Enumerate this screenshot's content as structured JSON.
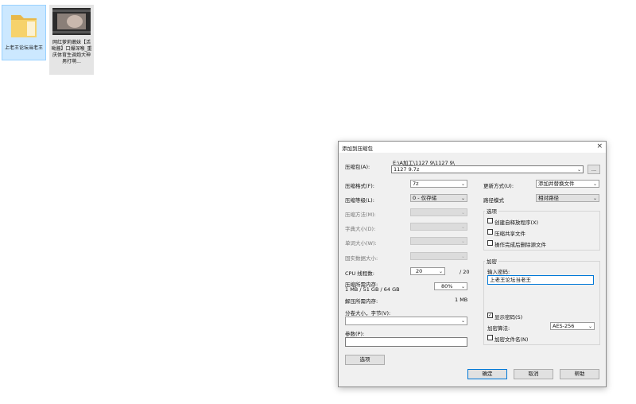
{
  "desktop": {
    "folder_label": "上老王论坛当老王",
    "video_label": "网红萝莉嫩妹【活呦酱】口爆深喉_重庆体育生调炮大神男打萌..."
  },
  "dialog": {
    "title": "添加到压缩包",
    "archive_label": "压缩包(A):",
    "archive_path": "E:\\A加工\\1127 9\\1127 9\\",
    "archive_name": "1127 9.7z",
    "browse": "...",
    "format_label": "压缩格式(F):",
    "format_value": "7z",
    "level_label": "压缩等级(L):",
    "level_value": "0 - 仅存储",
    "method_label": "压缩方法(M):",
    "dict_label": "字典大小(D):",
    "word_label": "单词大小(W):",
    "solid_label": "固实数据大小:",
    "cpu_label": "CPU 线程数:",
    "cpu_value": "20",
    "cpu_total": "/ 20",
    "mem_label": "压缩所需内存:",
    "mem_detail": "1 MB / 51 GB / 64 GB",
    "mem_percent": "80%",
    "decomp_label": "解压所需内存:",
    "decomp_value": "1 MB",
    "split_label": "分卷大小，字节(V):",
    "params_label": "参数(P):",
    "options_button": "选项",
    "update_label": "更新方式(U):",
    "update_value": "添加并替换文件",
    "path_label": "路径模式",
    "path_value": "相对路径",
    "options_group": "选项",
    "opt_sfx": "创建自释放程序(X)",
    "opt_shared": "压缩共享文件",
    "opt_delete": "操作完成后删除源文件",
    "encrypt_group": "加密",
    "password_label": "输入密码:",
    "password_value": "上老王论坛当老王",
    "show_password": "显示密码(S)",
    "enc_method_label": "加密算法:",
    "enc_method_value": "AES-256",
    "enc_names": "加密文件名(N)",
    "ok": "确定",
    "cancel": "取消",
    "help": "帮助"
  },
  "icons": {
    "close": "×",
    "dropdown": "⌄",
    "check": "✓"
  }
}
